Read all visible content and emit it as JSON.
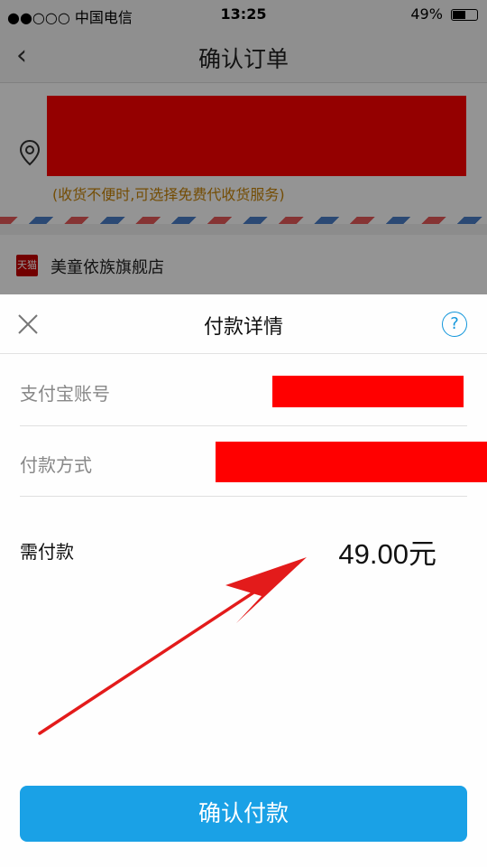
{
  "status_bar": {
    "carrier": "●●○○○ 中国电信",
    "time": "13:25",
    "battery": "49%",
    "battery_level": 0.49
  },
  "nav": {
    "title": "确认订单",
    "back_glyph": "‹"
  },
  "address": {
    "hint": "(收货不便时,可选择免费代收货服务)"
  },
  "shop": {
    "logo_text": "天猫",
    "name": "美童依族旗舰店"
  },
  "sheet": {
    "title": "付款详情",
    "help_glyph": "?",
    "rows": {
      "account_label": "支付宝账号",
      "method_label": "付款方式",
      "amount_label": "需付款",
      "amount_value": "49.00元"
    },
    "confirm_label": "确认付款"
  },
  "colors": {
    "accent": "#1aa1e6",
    "redaction": "#ff0000",
    "arrow": "#e31b1b",
    "hint": "#c8860a"
  }
}
